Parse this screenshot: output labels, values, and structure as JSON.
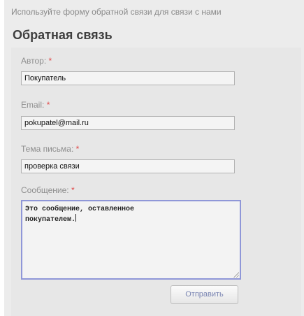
{
  "intro_text": "Используйте форму обратной связи для связи с нами",
  "form_title": "Обратная связь",
  "required_marker": "*",
  "fields": {
    "author": {
      "label": "Автор:",
      "value": "Покупатель"
    },
    "email": {
      "label": "Email:",
      "value": "pokupatel@mail.ru"
    },
    "subject": {
      "label": "Тема письма:",
      "value": "проверка связи"
    },
    "message": {
      "label": "Сообщение:",
      "value": "Это сообщение, оставленное\nпокупателем."
    }
  },
  "submit_label": "Отправить",
  "colors": {
    "required": "#e04848",
    "focus_border": "#8f97d8",
    "button_text": "#7b86b3"
  }
}
